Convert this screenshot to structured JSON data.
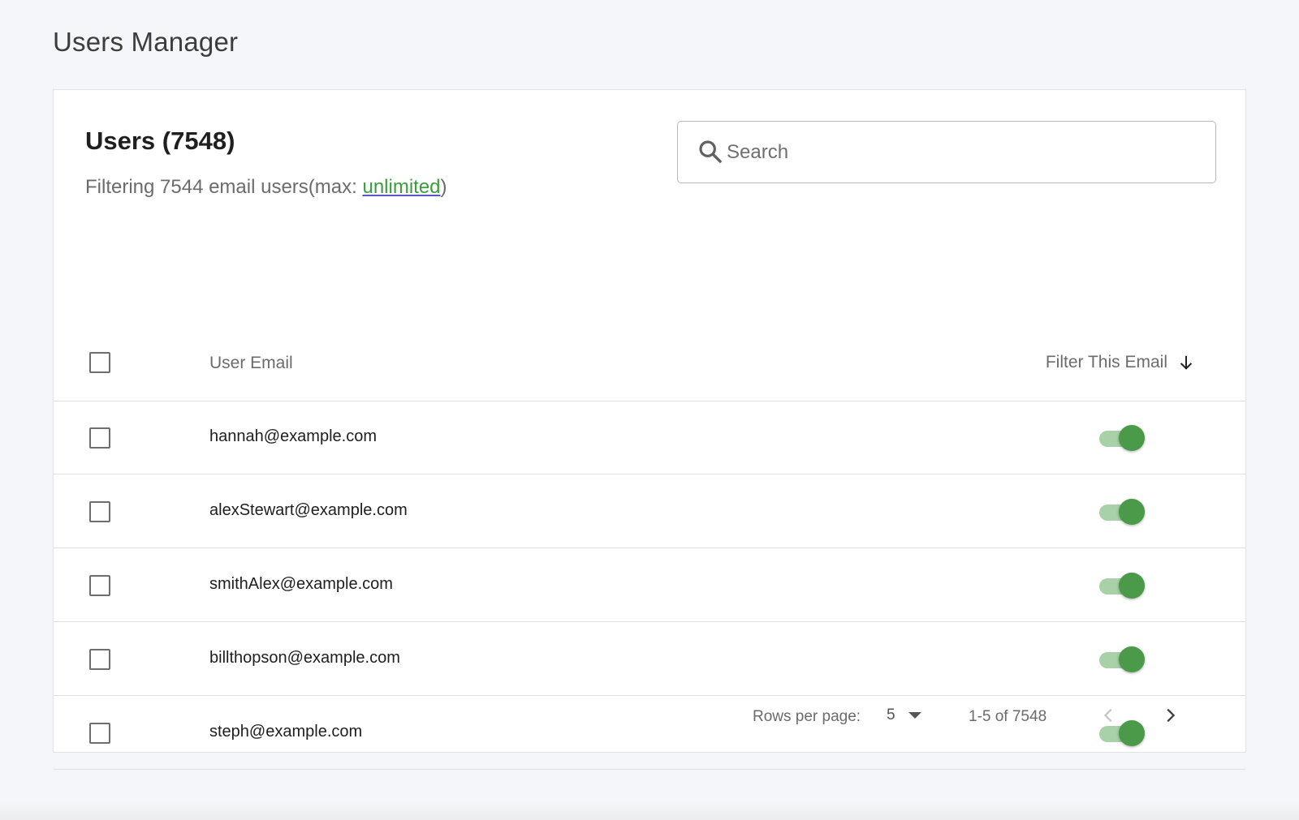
{
  "page": {
    "title": "Users Manager"
  },
  "card": {
    "title": "Users (7548)",
    "subtitle_prefix": "Filtering 7544 email users(max: ",
    "subtitle_link": "unlimited",
    "subtitle_suffix": ")"
  },
  "search": {
    "placeholder": "Search",
    "value": "",
    "icon": "search-icon"
  },
  "table": {
    "columns": {
      "email": "User Email",
      "filter": "Filter This Email",
      "sort_icon": "arrow-down-icon"
    },
    "rows": [
      {
        "email": "hannah@example.com",
        "filter_enabled": true
      },
      {
        "email": "alexStewart@example.com",
        "filter_enabled": true
      },
      {
        "email": "smithAlex@example.com",
        "filter_enabled": true
      },
      {
        "email": "billthopson@example.com",
        "filter_enabled": true
      },
      {
        "email": "steph@example.com",
        "filter_enabled": true
      }
    ]
  },
  "pagination": {
    "rows_per_page_label": "Rows per page:",
    "rows_per_page_value": "5",
    "range": "1-5 of 7548",
    "prev_icon": "chevron-left-icon",
    "next_icon": "chevron-right-icon"
  },
  "colors": {
    "background": "#f5f6f9",
    "accent_green": "#4a9a4a",
    "toggle_track": "#a8d1a8",
    "link_green": "#3b9d3b"
  }
}
